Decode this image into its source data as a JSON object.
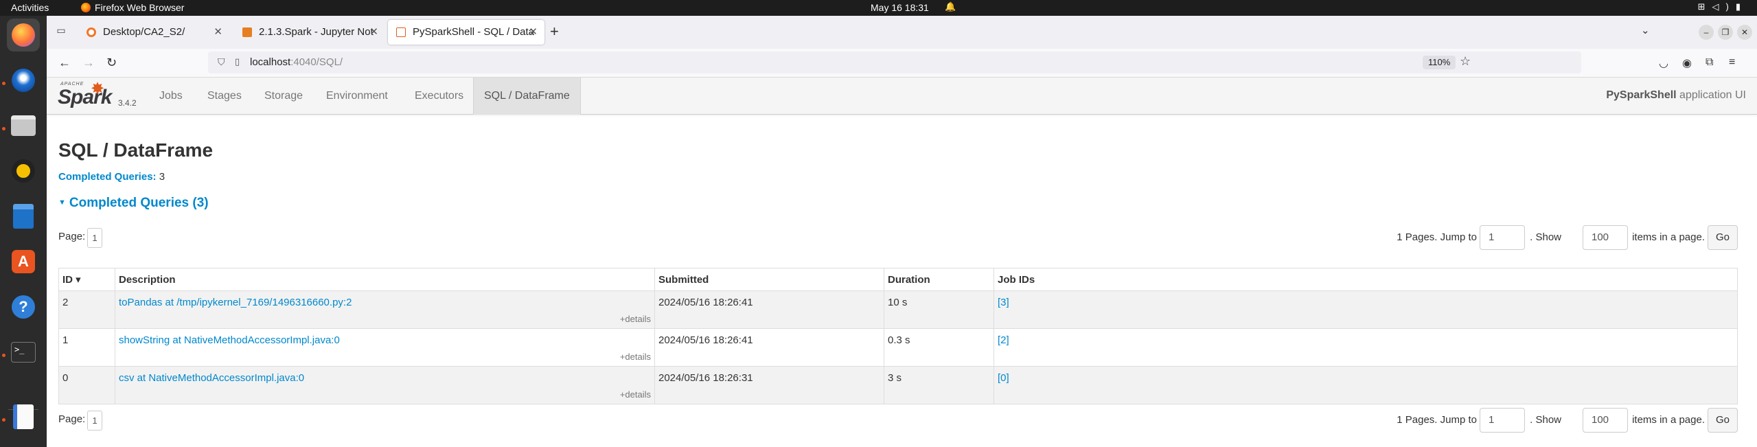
{
  "os": {
    "activities": "Activities",
    "app_name": "Firefox Web Browser",
    "clock": "May 16  18:31"
  },
  "browser": {
    "tabs": [
      {
        "label": "Desktop/CA2_S2/",
        "favicon_color": "#f37626"
      },
      {
        "label": "2.1.3.Spark - Jupyter Not",
        "favicon_color": "#e67e22"
      },
      {
        "label": "PySparkShell - SQL / Data",
        "favicon_color": "#e25a1c"
      }
    ],
    "url_host": "localhost",
    "url_path": ":4040/SQL/",
    "zoom": "110%"
  },
  "spark": {
    "version": "3.4.2",
    "nav": [
      "Jobs",
      "Stages",
      "Storage",
      "Environment",
      "Executors",
      "SQL / DataFrame"
    ],
    "active_nav": "SQL / DataFrame",
    "app_name": "PySparkShell",
    "app_suffix": " application UI",
    "page_title": "SQL / DataFrame",
    "completed_label": "Completed Queries:",
    "completed_count": "3",
    "section_title": "Completed Queries (3)",
    "pager": {
      "page_label": "Page:",
      "page": "1",
      "pages_text": "1 Pages. Jump to",
      "jump_value": "1",
      "show_text": ". Show",
      "show_value": "100",
      "items_text": "items in a page.",
      "go": "Go"
    },
    "columns": [
      "ID ▾",
      "Description",
      "Submitted",
      "Duration",
      "Job IDs"
    ],
    "rows": [
      {
        "id": "2",
        "description": "toPandas at /tmp/ipykernel_7169/1496316660.py:2",
        "details": "+details",
        "submitted": "2024/05/16 18:26:41",
        "duration": "10 s",
        "jobs": "[3]"
      },
      {
        "id": "1",
        "description": "showString at NativeMethodAccessorImpl.java:0",
        "details": "+details",
        "submitted": "2024/05/16 18:26:41",
        "duration": "0.3 s",
        "jobs": "[2]"
      },
      {
        "id": "0",
        "description": "csv at NativeMethodAccessorImpl.java:0",
        "details": "+details",
        "submitted": "2024/05/16 18:26:31",
        "duration": "3 s",
        "jobs": "[0]"
      }
    ]
  }
}
